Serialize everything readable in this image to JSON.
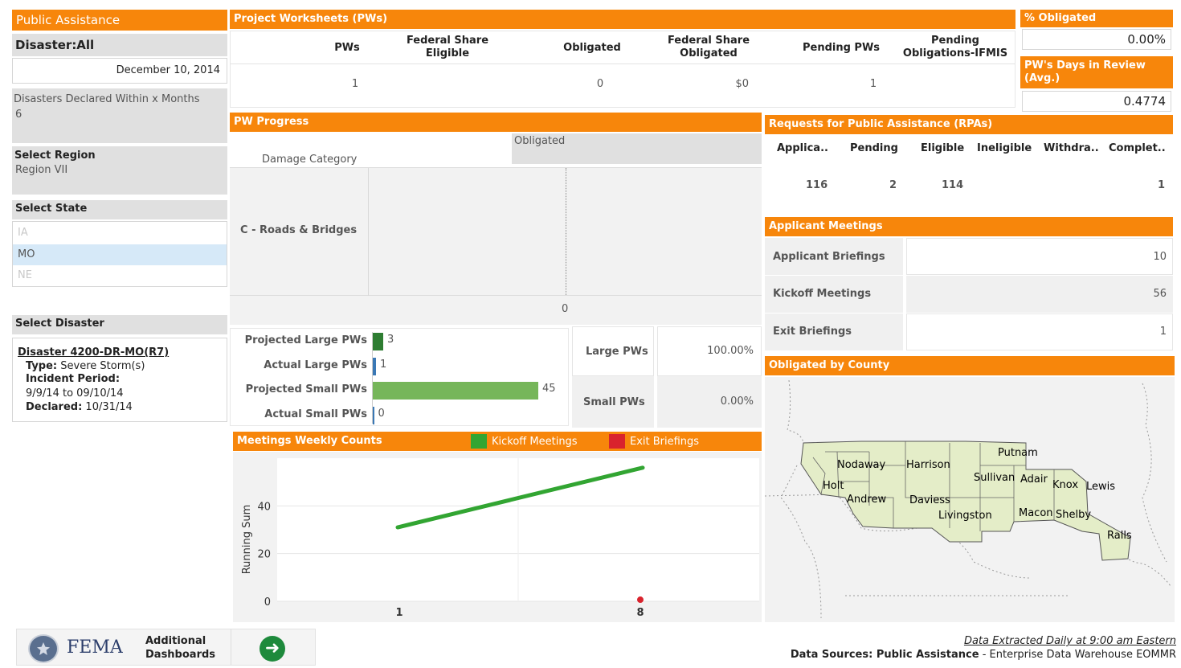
{
  "left": {
    "title": "Public Assistance",
    "disaster_all": "Disaster:All",
    "date": "December 10, 2014",
    "months_label": "Disasters Declared Within x Months",
    "months_value": "6",
    "region_label": "Select Region",
    "region_value": "Region VII",
    "state_label": "Select State",
    "states": [
      "IA",
      "MO",
      "NE"
    ],
    "selected_state": "MO",
    "disaster_label": "Select Disaster",
    "disaster": {
      "name": "Disaster 4200-DR-MO(R7)",
      "type_label": "Type:",
      "type_value": "Severe Storm(s)",
      "incident_label": "Incident Period:",
      "incident_value": "9/9/14 to 09/10/14",
      "declared_label": "Declared:",
      "declared_value": "10/31/14"
    }
  },
  "pws": {
    "title": "Project Worksheets (PWs)",
    "headers": [
      "PWs",
      "Federal Share Eligible",
      "Obligated",
      "Federal Share Obligated",
      "Pending PWs",
      "Pending Obligations-IFMIS"
    ],
    "values": [
      "1",
      "",
      "0",
      "$0",
      "1",
      ""
    ]
  },
  "pct_obligated": {
    "title": "% Obligated",
    "value": "0.00%"
  },
  "days_review": {
    "title": "PW's Days in Review (Avg.)",
    "value": "0.4774"
  },
  "pw_progress": {
    "title": "PW Progress",
    "col_obligated": "Obligated",
    "col_damage": "Damage Category",
    "row_label": "C - Roads & Bridges",
    "axis_zero": "0",
    "bars": [
      {
        "label": "Projected Large PWs",
        "value": 3,
        "text": "3",
        "color": "#2e7d32"
      },
      {
        "label": "Actual Large PWs",
        "value": 1,
        "text": "1",
        "color": "#3a78b5"
      },
      {
        "label": "Projected Small PWs",
        "value": 45,
        "text": "45",
        "color": "#76b65a"
      },
      {
        "label": "Actual Small PWs",
        "value": 0,
        "text": "0",
        "color": "#3a78b5"
      }
    ],
    "large_label": "Large PWs",
    "large_value": "100.00%",
    "small_label": "Small PWs",
    "small_value": "0.00%"
  },
  "meetings": {
    "title": "Meetings Weekly Counts",
    "legend": [
      {
        "name": "Kickoff Meetings",
        "color": "#32a532"
      },
      {
        "name": "Exit Briefings",
        "color": "#d9232d"
      }
    ]
  },
  "chart_data": {
    "type": "line",
    "x": [
      "1",
      "8"
    ],
    "series": [
      {
        "name": "Kickoff Meetings",
        "values": [
          31,
          56
        ]
      },
      {
        "name": "Exit Briefings",
        "values": [
          null,
          1
        ]
      }
    ],
    "ylabel": "Running Sum",
    "yticks": [
      "0",
      "20",
      "40"
    ],
    "ylim": [
      0,
      60
    ],
    "grid": true
  },
  "rpa": {
    "title": "Requests for Public Assistance (RPAs)",
    "headers": [
      "Applica..",
      "Pending",
      "Eligible",
      "Ineligible",
      "Withdra..",
      "Complet.."
    ],
    "values": [
      "116",
      "2",
      "114",
      "",
      "",
      "1"
    ]
  },
  "applicant_meetings": {
    "title": "Applicant Meetings",
    "rows": [
      {
        "label": "Applicant Briefings",
        "value": "10"
      },
      {
        "label": "Kickoff Meetings",
        "value": "56"
      },
      {
        "label": "Exit Briefings",
        "value": "1"
      }
    ]
  },
  "county": {
    "title": "Obligated by County",
    "names": [
      "Putnam",
      "Nodaway",
      "Harrison",
      "Sullivan",
      "Adair",
      "Knox",
      "Lewis",
      "Holt",
      "Andrew",
      "Daviess",
      "Livingston",
      "Macon",
      "Shelby",
      "Ralls"
    ],
    "fill": "#e4edc8"
  },
  "footer": {
    "fema": "FEMA",
    "additional": "Additional",
    "dashboards": "Dashboards",
    "extracted": "Data Extracted  Daily at 9:00 am Eastern",
    "sources_label": "Data Sources: Public Assistance",
    "sources_rest": " - Enterprise Data Warehouse EOMMR"
  },
  "colors": {
    "accent": "#f7860b",
    "header_gray": "#e0e0e0",
    "select_blue": "#d6e9f8"
  }
}
